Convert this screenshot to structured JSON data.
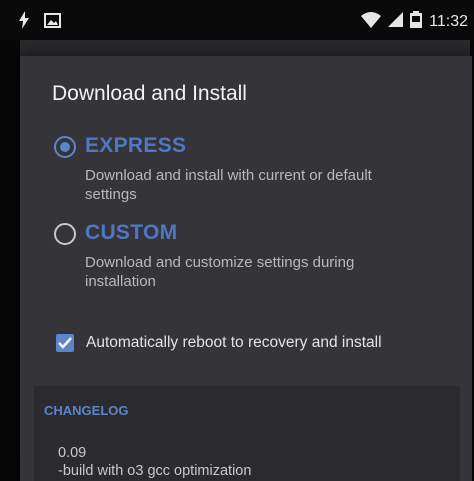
{
  "status_bar": {
    "left_icons": [
      "charging-bolt-icon",
      "gallery-icon"
    ],
    "right_icons": [
      "wifi-icon",
      "cell-signal-icon",
      "battery-icon"
    ],
    "time": "11:32"
  },
  "dialog": {
    "title": "Download and Install",
    "options": [
      {
        "label": "EXPRESS",
        "description": "Download and install with current or default settings",
        "selected": true
      },
      {
        "label": "CUSTOM",
        "description": "Download and customize settings during installation",
        "selected": false
      }
    ],
    "auto_reboot": {
      "label": "Automatically reboot to recovery and install",
      "checked": true
    },
    "changelog": {
      "header": "CHANGELOG",
      "version": "0.09",
      "entry": "-build with o3 gcc optimization"
    }
  },
  "colors": {
    "accent": "#5b86c9",
    "dialog_bg": "#343439",
    "status_bar_bg": "#0a0a0b"
  }
}
